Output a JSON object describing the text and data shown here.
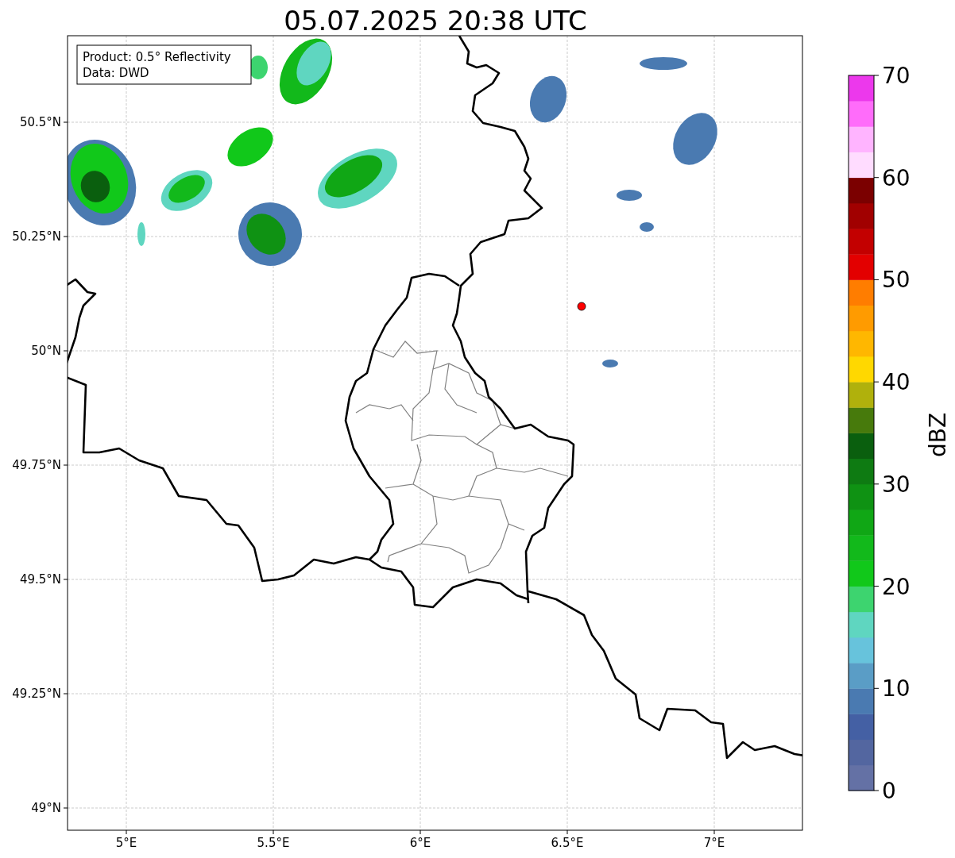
{
  "title": "05.07.2025 20:38 UTC",
  "info_box": {
    "lines": [
      "Product: 0.5° Reflectivity",
      "Data: DWD"
    ]
  },
  "map": {
    "x_ticks": [
      "5°E",
      "5.5°E",
      "6°E",
      "6.5°E",
      "7°E"
    ],
    "y_ticks": [
      "50.5°N",
      "50.25°N",
      "50°N",
      "49.75°N",
      "49.5°N",
      "49.25°N",
      "49°N"
    ]
  },
  "colorbar": {
    "label": "dBZ",
    "ticks": [
      "70",
      "60",
      "50",
      "40",
      "30",
      "20",
      "10",
      "0"
    ],
    "bands": [
      {
        "color": "#6471a5"
      },
      {
        "color": "#5366a0"
      },
      {
        "color": "#4460a4"
      },
      {
        "color": "#4a7ab1"
      },
      {
        "color": "#5a9dc6"
      },
      {
        "color": "#67c3dc"
      },
      {
        "color": "#5fd6c0"
      },
      {
        "color": "#3dd46f"
      },
      {
        "color": "#11c81a"
      },
      {
        "color": "#12b91b"
      },
      {
        "color": "#10a715"
      },
      {
        "color": "#0f9213"
      },
      {
        "color": "#0e7b12"
      },
      {
        "color": "#0a5f0e"
      },
      {
        "color": "#477a0c"
      },
      {
        "color": "#b0b10c"
      },
      {
        "color": "#ffd800"
      },
      {
        "color": "#ffb700"
      },
      {
        "color": "#ff9b00"
      },
      {
        "color": "#ff7d00"
      },
      {
        "color": "#e30000"
      },
      {
        "color": "#c30000"
      },
      {
        "color": "#a10000"
      },
      {
        "color": "#7b0000"
      },
      {
        "color": "#ffdcff"
      },
      {
        "color": "#ffb4ff"
      },
      {
        "color": "#ff6cfa"
      },
      {
        "color": "#ec38ec"
      }
    ]
  }
}
